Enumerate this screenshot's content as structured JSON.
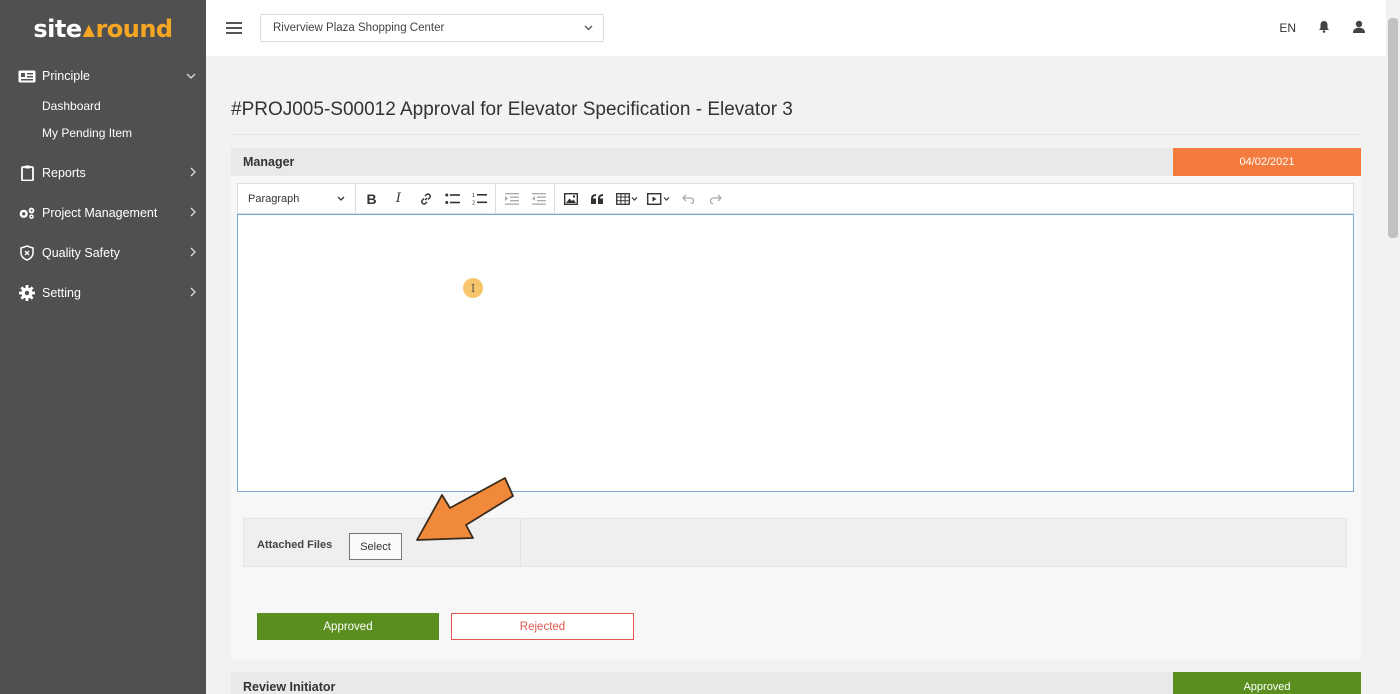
{
  "app": {
    "logo_part1": "site",
    "logo_caret": "▲",
    "logo_part2": "round"
  },
  "sidebar": {
    "groups": [
      {
        "label": "Principle",
        "icon": "id-card-icon",
        "expanded": true
      },
      {
        "label": "Reports",
        "icon": "clipboard-icon"
      },
      {
        "label": "Project Management",
        "icon": "gears-icon"
      },
      {
        "label": "Quality Safety",
        "icon": "shield-icon"
      },
      {
        "label": "Setting",
        "icon": "gear-icon"
      }
    ],
    "sub_items": [
      "Dashboard",
      "My Pending Item"
    ]
  },
  "header": {
    "project": "Riverview Plaza Shopping Center",
    "language": "EN"
  },
  "page": {
    "title": "#PROJ005-S00012 Approval for Elevator Specification - Elevator 3"
  },
  "manager": {
    "label": "Manager",
    "date": "04/02/2021",
    "toolbar": {
      "paragraph": "Paragraph",
      "bold": "B",
      "italic": "I"
    },
    "editor_value": "",
    "attached_files_label": "Attached Files",
    "select_label": "Select",
    "approved_label": "Approved",
    "rejected_label": "Rejected"
  },
  "review": {
    "label": "Review Initiator",
    "status": "Approved"
  },
  "colors": {
    "sidebar_bg": "#505050",
    "logo_accent": "#f5a623",
    "date_badge": "#f47b3e",
    "approved": "#5a8f20",
    "rejected": "#e0574f",
    "arrow": "#f08a3a"
  }
}
